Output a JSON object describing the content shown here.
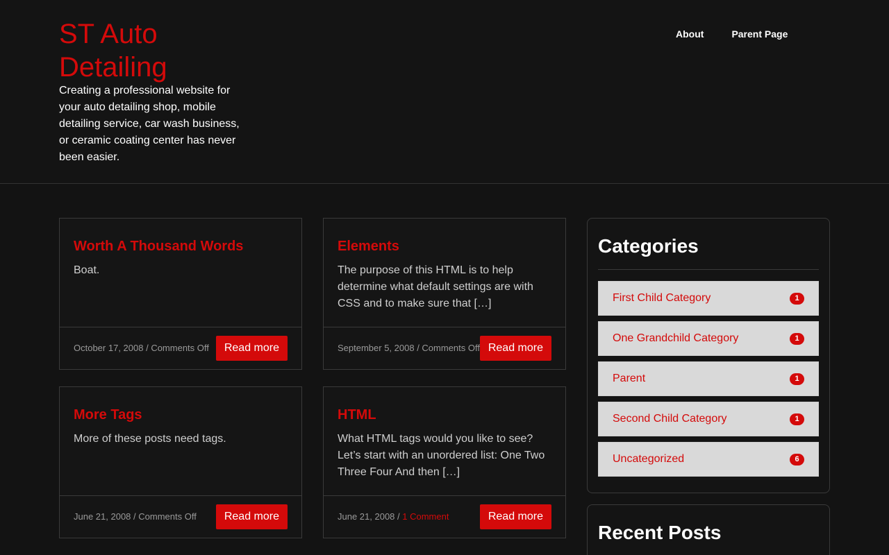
{
  "site": {
    "title": "ST Auto Detailing",
    "tagline": "Creating a professional website for your auto detailing shop, mobile detailing service, car wash business, or ceramic coating center has never been easier."
  },
  "nav": {
    "items": [
      {
        "label": "About"
      },
      {
        "label": "Parent Page"
      }
    ]
  },
  "posts": [
    {
      "title": "Worth A Thousand Words",
      "excerpt": "Boat.",
      "date": "October 17, 2008",
      "separator": " / ",
      "comments": "Comments Off",
      "read_more": "Read more"
    },
    {
      "title": "Elements",
      "excerpt": "The purpose of this HTML is to help determine what default settings are with CSS and to make sure that […]",
      "date": "September 5, 2008",
      "separator": " / ",
      "comments": "Comments Off",
      "read_more": "Read more"
    },
    {
      "title": "More Tags",
      "excerpt": "More of these posts need tags.",
      "date": "June 21, 2008",
      "separator": " / ",
      "comments": "Comments Off",
      "read_more": "Read more"
    },
    {
      "title": "HTML",
      "excerpt": "What HTML tags would you like to see? Let’s start with an unordered list: One Two Three Four And then […]",
      "date": "June 21, 2008",
      "separator": " / ",
      "comments": "1 Comment",
      "read_more": "Read more"
    }
  ],
  "sidebar": {
    "categories": {
      "title": "Categories",
      "items": [
        {
          "label": "First Child Category",
          "count": "1"
        },
        {
          "label": "One Grandchild Category",
          "count": "1"
        },
        {
          "label": "Parent",
          "count": "1"
        },
        {
          "label": "Second Child Category",
          "count": "1"
        },
        {
          "label": "Uncategorized",
          "count": "6"
        }
      ]
    },
    "recent_posts": {
      "title": "Recent Posts"
    }
  },
  "colors": {
    "accent": "#d40a0a",
    "background": "#131313"
  }
}
